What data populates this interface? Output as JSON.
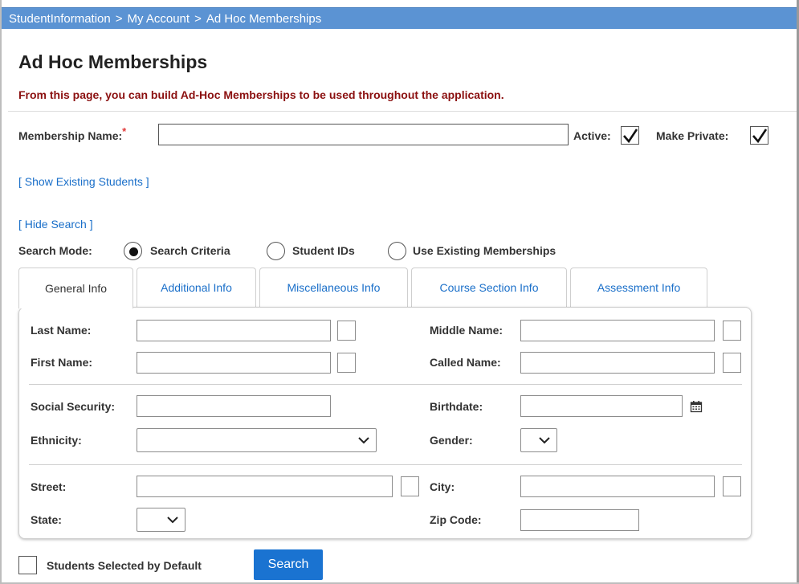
{
  "breadcrumb": {
    "items": [
      "StudentInformation",
      "My Account",
      "Ad Hoc Memberships"
    ],
    "separator": ">"
  },
  "page": {
    "title": "Ad Hoc Memberships",
    "intro": "From this page, you can build Ad-Hoc Memberships to be used throughout the application."
  },
  "membership": {
    "name_label": "Membership Name:",
    "required_mark": "*",
    "name_value": "",
    "active_label": "Active:",
    "active_checked": true,
    "private_label": "Make Private:",
    "private_checked": true
  },
  "links": {
    "show_existing": "[ Show Existing Students ]",
    "hide_search": "[ Hide Search ]"
  },
  "search_mode": {
    "label": "Search Mode:",
    "options": [
      "Search Criteria",
      "Student IDs",
      "Use Existing Memberships"
    ],
    "selected": "Search Criteria"
  },
  "tabs": [
    "General Info",
    "Additional Info",
    "Miscellaneous Info",
    "Course Section Info",
    "Assessment Info"
  ],
  "active_tab": "General Info",
  "form": {
    "last_name": "Last Name:",
    "middle_name": "Middle Name:",
    "first_name": "First Name:",
    "called_name": "Called Name:",
    "social_security": "Social Security:",
    "birthdate": "Birthdate:",
    "ethnicity": "Ethnicity:",
    "gender": "Gender:",
    "street": "Street:",
    "city": "City:",
    "state": "State:",
    "zip_code": "Zip Code:"
  },
  "footer": {
    "default_label": "Students Selected by Default",
    "default_checked": false,
    "search_button": "Search"
  },
  "colors": {
    "breadcrumb_bg": "#5b93d3",
    "intro_text": "#8b1010",
    "link": "#1a6fc9",
    "button": "#1a73d1",
    "required": "#e23b3b"
  },
  "icons": {
    "checkmark": "check-icon",
    "dropdown": "chevron-down-icon",
    "calendar": "calendar-icon"
  }
}
